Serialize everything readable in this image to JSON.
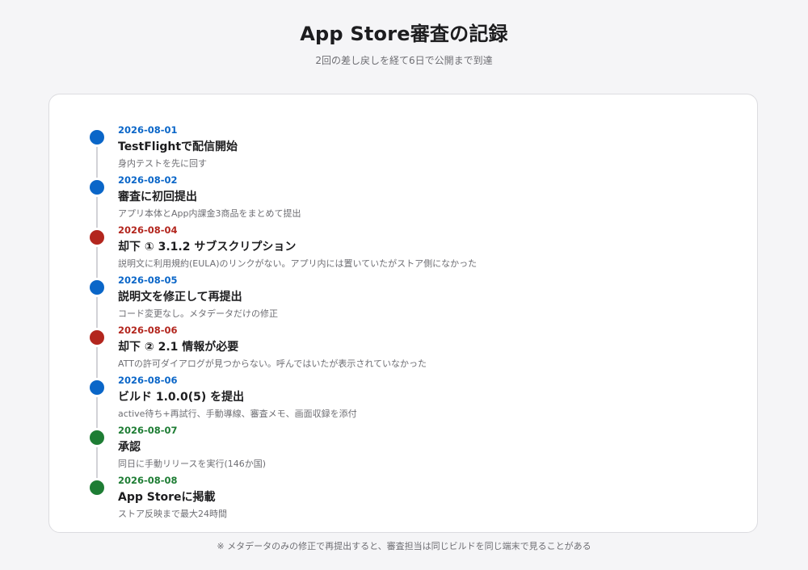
{
  "header": {
    "title": "App Store審査の記録",
    "subtitle": "2回の差し戻しを経て6日で公開まで到達"
  },
  "colors": {
    "submitted": "#0a66c8",
    "rejected": "#b3261e",
    "approved": "#1e7d34"
  },
  "events": [
    {
      "date": "2026-08-01",
      "title": "TestFlightで配信開始",
      "description": "身内テストを先に回す",
      "status": "blue"
    },
    {
      "date": "2026-08-02",
      "title": "審査に初回提出",
      "description": "アプリ本体とApp内課金3商品をまとめて提出",
      "status": "blue"
    },
    {
      "date": "2026-08-04",
      "title": "却下 ① 3.1.2 サブスクリプション",
      "description": "説明文に利用規約(EULA)のリンクがない。アプリ内には置いていたがストア側になかった",
      "status": "red"
    },
    {
      "date": "2026-08-05",
      "title": "説明文を修正して再提出",
      "description": "コード変更なし。メタデータだけの修正",
      "status": "blue"
    },
    {
      "date": "2026-08-06",
      "title": "却下 ② 2.1 情報が必要",
      "description": "ATTの許可ダイアログが見つからない。呼んではいたが表示されていなかった",
      "status": "red"
    },
    {
      "date": "2026-08-06",
      "title": "ビルド 1.0.0(5) を提出",
      "description": "active待ち+再試行、手動導線、審査メモ、画面収録を添付",
      "status": "blue"
    },
    {
      "date": "2026-08-07",
      "title": "承認",
      "description": "同日に手動リリースを実行(146か国)",
      "status": "green"
    },
    {
      "date": "2026-08-08",
      "title": "App Storeに掲載",
      "description": "ストア反映まで最大24時間",
      "status": "green"
    }
  ],
  "footnote": "※ メタデータのみの修正で再提出すると、審査担当は同じビルドを同じ端末で見ることがある"
}
